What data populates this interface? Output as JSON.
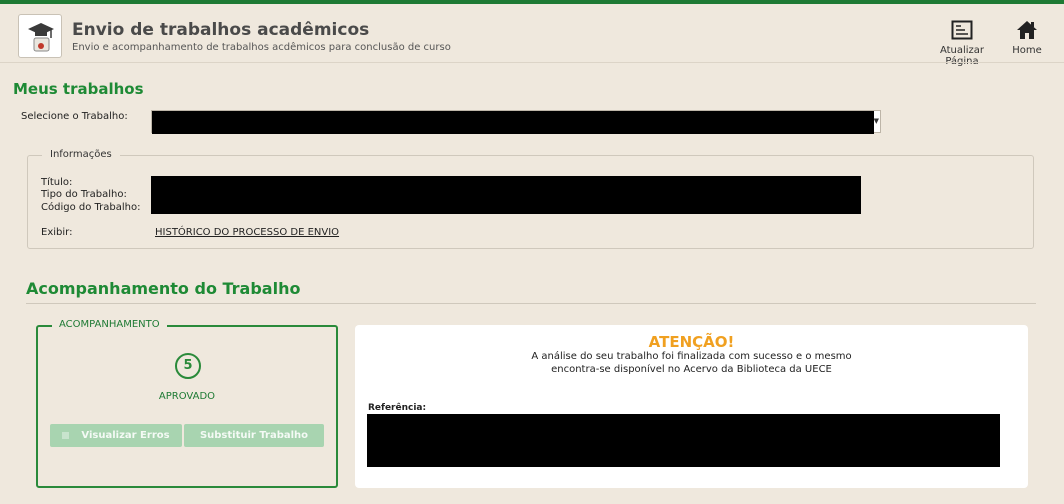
{
  "header": {
    "title": "Envio de trabalhos acadêmicos",
    "subtitle": "Envio e acompanhamento de trabalhos acdêmicos para conclusão de curso",
    "logo_icon": "graduation-diploma-icon",
    "refresh_label": "Atualizar Página",
    "refresh_icon": "refresh-page-icon",
    "home_label": "Home",
    "home_icon": "home-icon"
  },
  "meus_trabalhos": {
    "title": "Meus trabalhos",
    "select_label": "Selecione o Trabalho:"
  },
  "informacoes": {
    "legend": "Informações",
    "titulo_label": "Título:",
    "tipo_label": "Tipo do Trabalho:",
    "codigo_label": "Código do Trabalho:",
    "exibir_label": "Exibir:",
    "historico_link": "HISTÓRICO DO PROCESSO DE ENVIO"
  },
  "acompanhamento": {
    "title": "Acompanhamento do Trabalho",
    "legend": "ACOMPANHAMENTO",
    "step": "5",
    "status": "APROVADO",
    "btn_erros": "Visualizar Erros",
    "btn_substituir": "Substituir Trabalho"
  },
  "aviso": {
    "title": "ATENÇÃO!",
    "line1": "A análise do seu trabalho foi finalizada com sucesso e o mesmo",
    "line2": "encontra-se disponível no Acervo da Biblioteca da UECE",
    "referencia_label": "Referência:"
  },
  "colors": {
    "accent_green": "#1e8a35",
    "warning_orange": "#f0a020",
    "background": "#efe8dd"
  }
}
